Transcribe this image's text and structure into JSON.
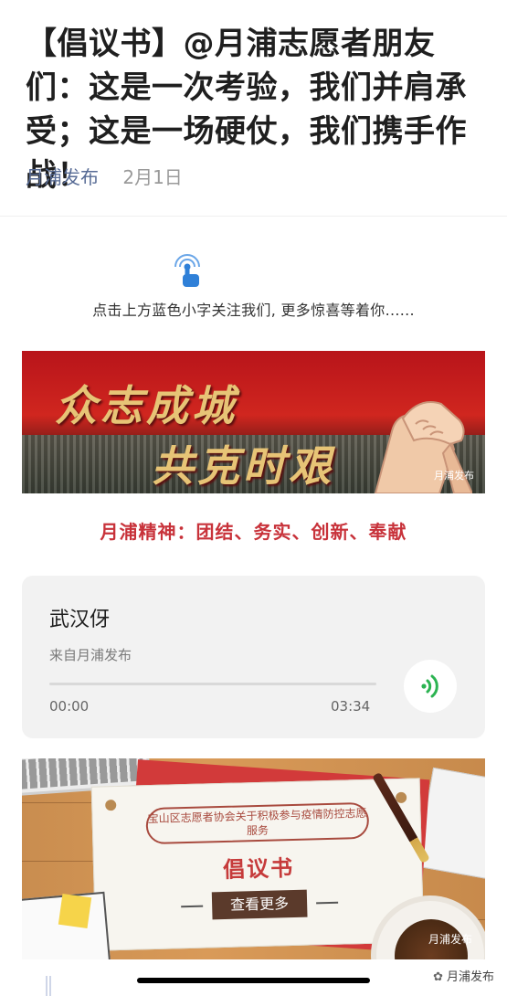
{
  "article": {
    "title": "【倡议书】@月浦志愿者朋友们：这是一次考验，我们并肩承受；这是一场硬仗，我们携手作战！",
    "account": "月浦发布",
    "date": "2月1日"
  },
  "follow_prompt": {
    "icon": "tap-icon",
    "text": "点击上方蓝色小字关注我们, 更多惊喜等着你......"
  },
  "banner": {
    "slogan_line1": "众志成城",
    "slogan_line2": "共克时艰",
    "watermark": "月浦发布",
    "colors": {
      "primary": "#c8141a",
      "text": "#e7c476"
    }
  },
  "spirit_text": "月浦精神：团结、务实、创新、奉献",
  "audio": {
    "title": "武汉伢",
    "source": "来自月浦发布",
    "current_time": "00:00",
    "duration": "03:34",
    "progress": 0,
    "play_icon": "audio-wave-icon",
    "accent_color": "#2bb351"
  },
  "poster": {
    "headline": "宝山区志愿者协会关于积极参与疫情防控志愿服务",
    "title": "倡议书",
    "more_button": "查看更多",
    "watermark": "月浦发布"
  },
  "footer": {
    "watermark": "月浦发布"
  }
}
